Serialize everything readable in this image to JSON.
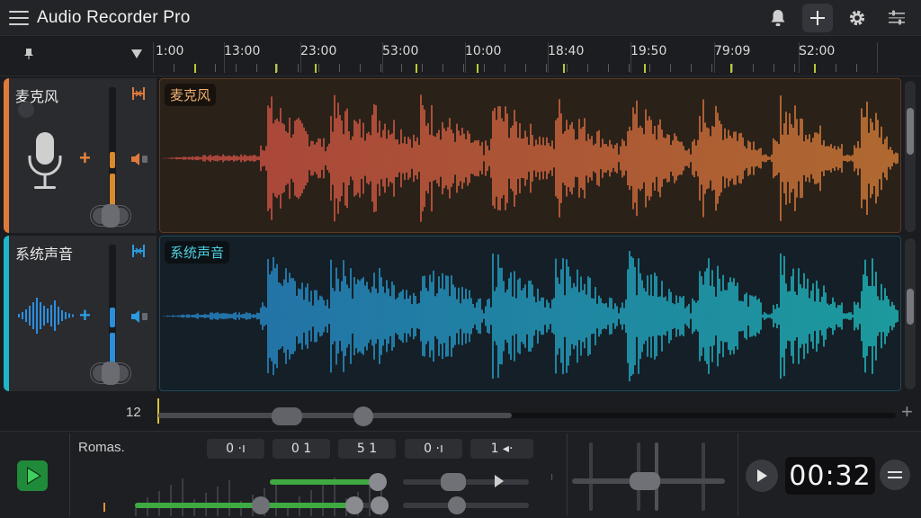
{
  "app": {
    "title": "Audio Recorder Pro"
  },
  "toolbar": {
    "icons": [
      "menu-icon",
      "bell-icon",
      "plus-icon",
      "gear-icon",
      "sliders-icon"
    ]
  },
  "ruler": {
    "labels": [
      "1:00",
      "13:00",
      "23:00",
      "53:00",
      "10:00",
      "18:40",
      "19:50",
      "79:09",
      "S2:00"
    ]
  },
  "tracks": [
    {
      "name": "麦克风",
      "clip_label": "麦克风",
      "accent": "#e07a3a",
      "icon": "microphone-icon"
    },
    {
      "name": "系统声音",
      "clip_label": "系统声音",
      "accent": "#1fb6c9",
      "icon": "waveform-icon"
    }
  ],
  "timeline": {
    "zoom_label": "12"
  },
  "mixer": {
    "name": "Romas.",
    "chips": [
      "0 ·ı",
      "0 1",
      "5 1",
      "0 ·ı",
      "1 ◂·"
    ],
    "timer": "00:32"
  },
  "colors": {
    "mic_start": "#e0504a",
    "mic_end": "#e8883a",
    "sys_start": "#2a8fe0",
    "sys_end": "#1fcfcf",
    "green": "#3eaa42"
  }
}
